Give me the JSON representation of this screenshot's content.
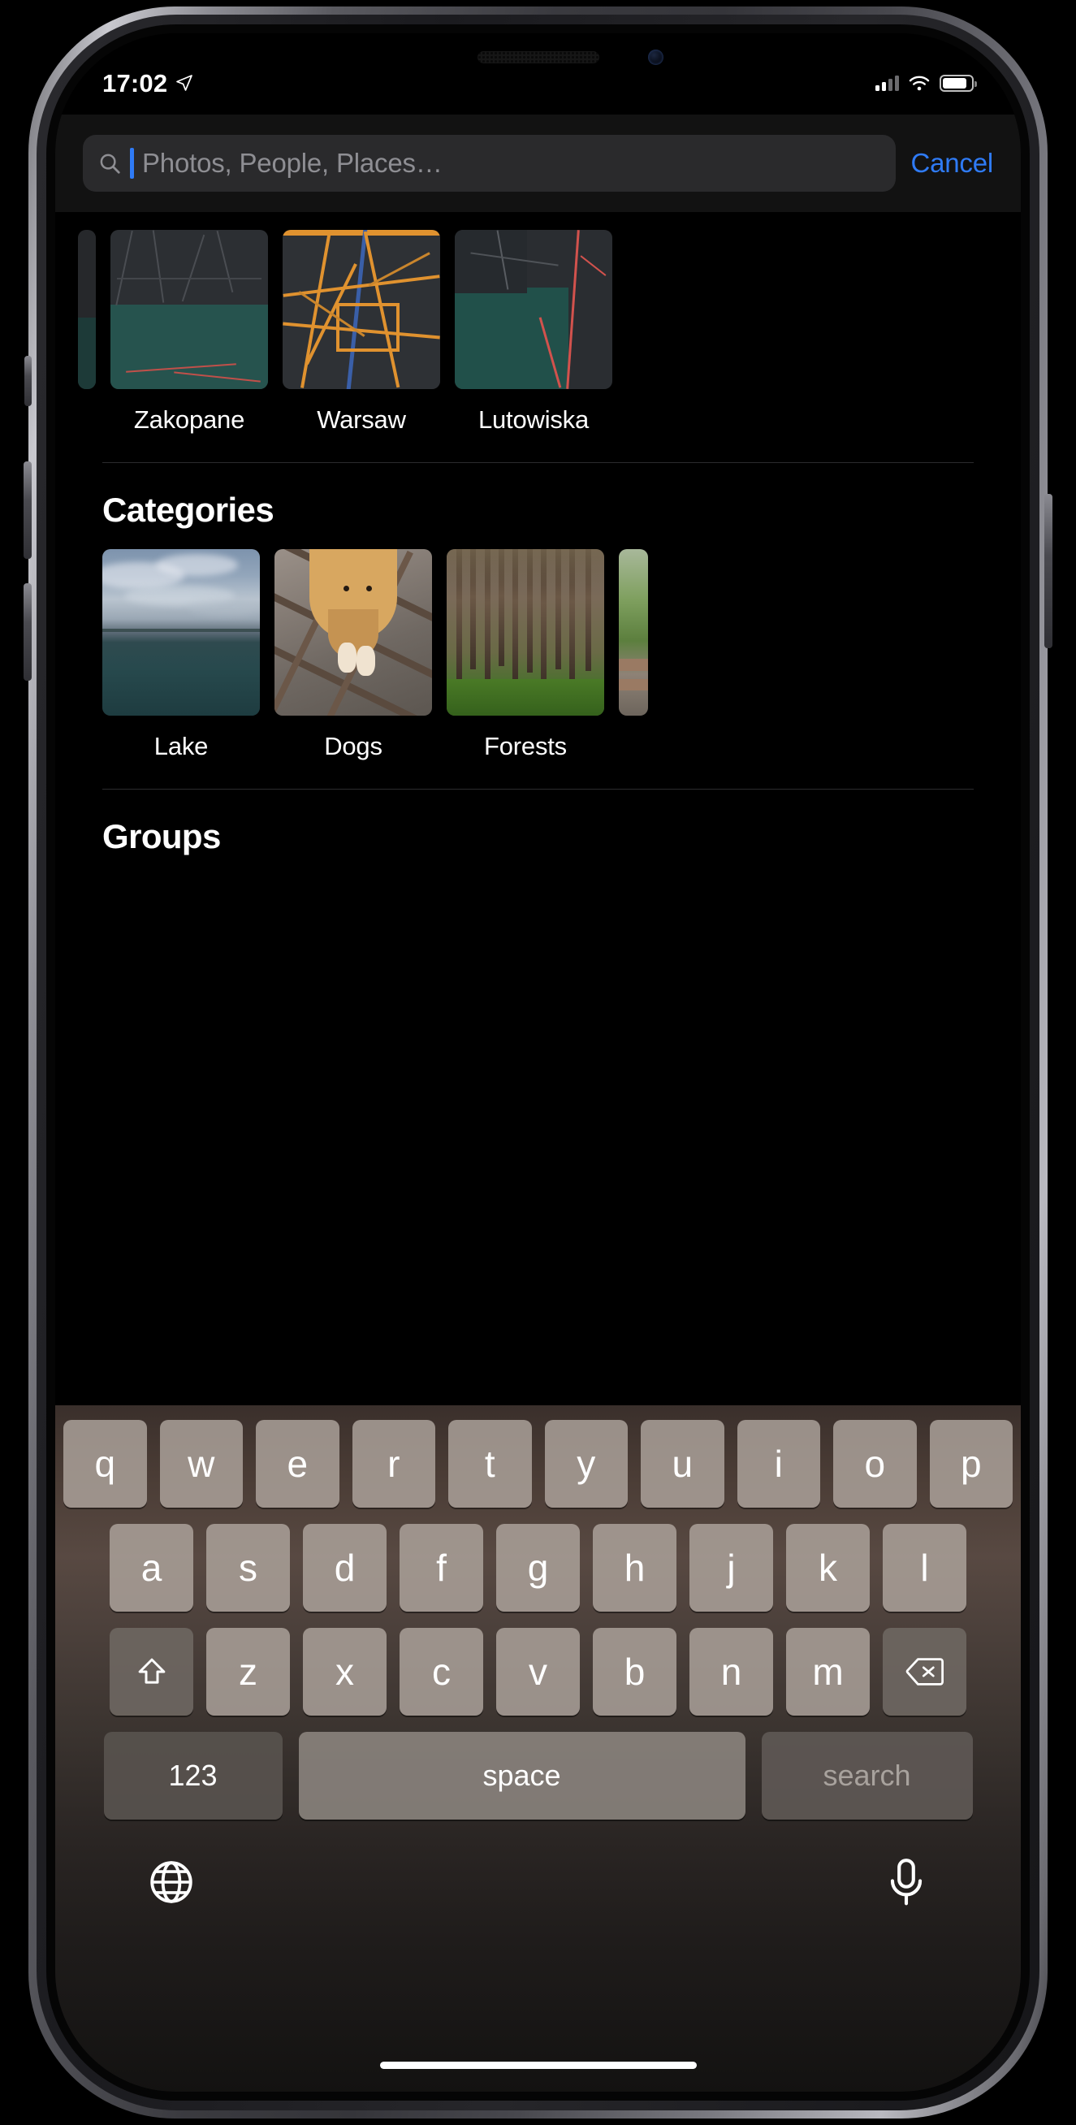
{
  "status_bar": {
    "time": "17:02",
    "location_icon": "location-arrow-icon",
    "signal_icon": "cellular-signal-icon",
    "signal_bars": 2,
    "wifi_icon": "wifi-icon",
    "battery_icon": "battery-icon",
    "battery_level_percent": 85
  },
  "search": {
    "icon": "search-icon",
    "value": "",
    "placeholder": "Photos, People, Places…",
    "cancel_label": "Cancel"
  },
  "places": {
    "items": [
      {
        "label": "",
        "clipped": true
      },
      {
        "label": "Zakopane",
        "clipped": false
      },
      {
        "label": "Warsaw",
        "clipped": false
      },
      {
        "label": "Lutowiska",
        "clipped": false
      }
    ]
  },
  "categories": {
    "title": "Categories",
    "items": [
      {
        "label": "Lake",
        "clipped": false
      },
      {
        "label": "Dogs",
        "clipped": false
      },
      {
        "label": "Forests",
        "clipped": false
      },
      {
        "label": "",
        "clipped": true
      }
    ]
  },
  "groups": {
    "title": "Groups"
  },
  "keyboard": {
    "row1": [
      "q",
      "w",
      "e",
      "r",
      "t",
      "y",
      "u",
      "i",
      "o",
      "p"
    ],
    "row2": [
      "a",
      "s",
      "d",
      "f",
      "g",
      "h",
      "j",
      "k",
      "l"
    ],
    "row3_letters": [
      "z",
      "x",
      "c",
      "v",
      "b",
      "n",
      "m"
    ],
    "shift_icon": "shift-arrow-icon",
    "backspace_icon": "backspace-icon",
    "numbers_label": "123",
    "space_label": "space",
    "search_label": "search",
    "globe_icon": "globe-icon",
    "microphone_icon": "microphone-icon"
  },
  "colors": {
    "accent_blue": "#2f7bf6",
    "screen_background": "#000000",
    "search_field": "#2a2a2c",
    "placeholder_text": "#8e8e93"
  }
}
